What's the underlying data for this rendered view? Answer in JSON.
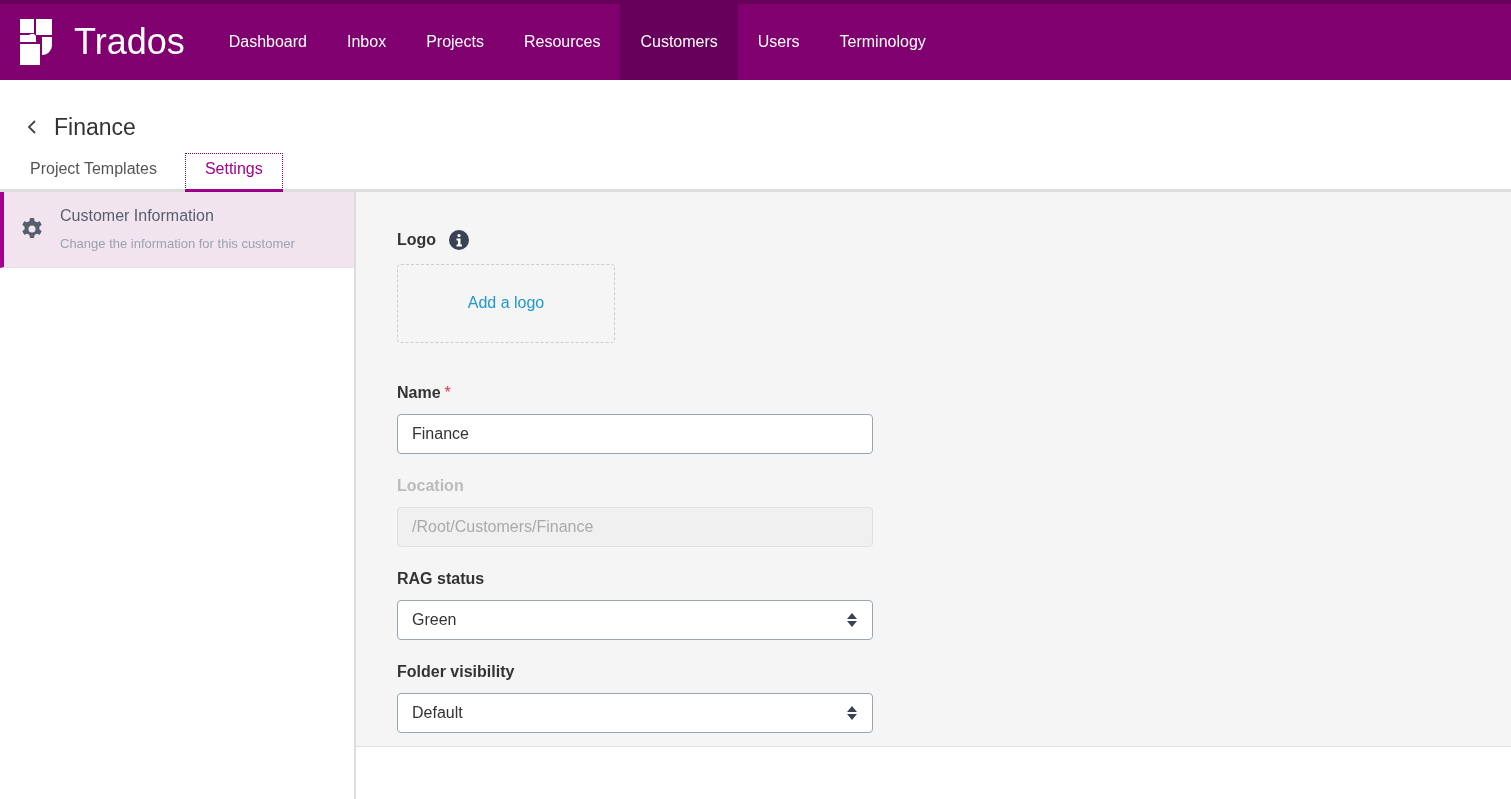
{
  "app": {
    "brand": "Trados"
  },
  "nav": [
    {
      "label": "Dashboard",
      "selected": false
    },
    {
      "label": "Inbox",
      "selected": false
    },
    {
      "label": "Projects",
      "selected": false
    },
    {
      "label": "Resources",
      "selected": false
    },
    {
      "label": "Customers",
      "selected": true
    },
    {
      "label": "Users",
      "selected": false
    },
    {
      "label": "Terminology",
      "selected": false
    }
  ],
  "page": {
    "title": "Finance"
  },
  "tabs": [
    {
      "label": "Project Templates",
      "selected": false
    },
    {
      "label": "Settings",
      "selected": true
    }
  ],
  "sidebar": {
    "items": [
      {
        "title": "Customer Information",
        "subtitle": "Change the information for this customer",
        "selected": true
      }
    ]
  },
  "logo": {
    "label": "Logo",
    "link": "Add a logo"
  },
  "fields": [
    {
      "kind": "text",
      "label": "Name",
      "required_mark": "*",
      "disabled": false,
      "value": "Finance"
    },
    {
      "kind": "text",
      "label": "Location",
      "disabled": true,
      "value": "/Root/Customers/Finance"
    },
    {
      "kind": "select",
      "label": "RAG status",
      "disabled": false,
      "value": "Green"
    },
    {
      "kind": "select",
      "label": "Folder visibility",
      "disabled": false,
      "value": "Default"
    }
  ]
}
